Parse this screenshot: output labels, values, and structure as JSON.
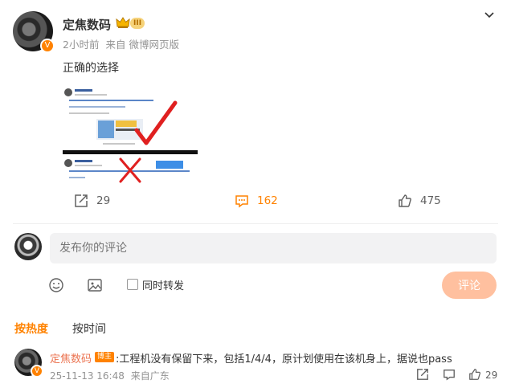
{
  "post": {
    "author": "定焦数码",
    "level_badge": "III",
    "time": "2小时前",
    "source_prefix": "来自",
    "source": "微博网页版",
    "text": "正确的选择",
    "actions": {
      "repost_count": "29",
      "comment_count": "162",
      "like_count": "475"
    }
  },
  "composer": {
    "placeholder": "发布你的评论",
    "forward_label": "同时转发",
    "submit_label": "评论"
  },
  "sort": {
    "hot": "按热度",
    "time": "按时间"
  },
  "comments": [
    {
      "author": "定焦数码",
      "tag": "博主",
      "text": ":工程机没有保留下来，包括1/4/4，原计划使用在该机身上，据说也pass",
      "date": "25-11-13 16:48",
      "location": "来自广东",
      "like_count": "29"
    }
  ],
  "colors": {
    "accent": "#ff8200",
    "comment_author": "#eb7350",
    "submit_bg": "#ffc09f"
  },
  "icons": [
    "chevron-down-icon",
    "verified-icon",
    "crown-icon",
    "repost-icon",
    "comment-icon",
    "like-icon",
    "emoji-icon",
    "image-icon"
  ]
}
